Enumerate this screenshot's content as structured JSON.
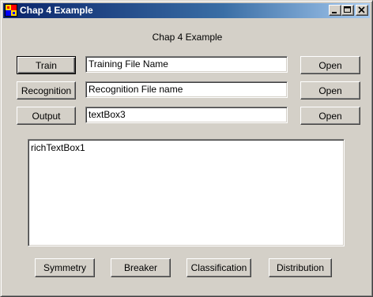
{
  "window": {
    "title": "Chap 4 Example",
    "icon": "app-grid-icon"
  },
  "titlebar_buttons": {
    "minimize_icon": "minimize-icon",
    "maximize_icon": "maximize-icon",
    "close_icon": "close-icon"
  },
  "form": {
    "heading": "Chap 4 Example",
    "rows": [
      {
        "button_label": "Train",
        "textbox_value": "Training File Name",
        "open_label": "Open"
      },
      {
        "button_label": "Recognition",
        "textbox_value": "Recognition File name",
        "open_label": "Open"
      },
      {
        "button_label": "Output",
        "textbox_value": "textBox3",
        "open_label": "Open"
      }
    ],
    "rich_text": "richTextBox1",
    "bottom_buttons": [
      "Symmetry",
      "Breaker",
      "Classification",
      "Distribution"
    ]
  },
  "colors": {
    "face": "#d4d0c8",
    "title_start": "#0a246a",
    "title_end": "#a6caf0"
  }
}
